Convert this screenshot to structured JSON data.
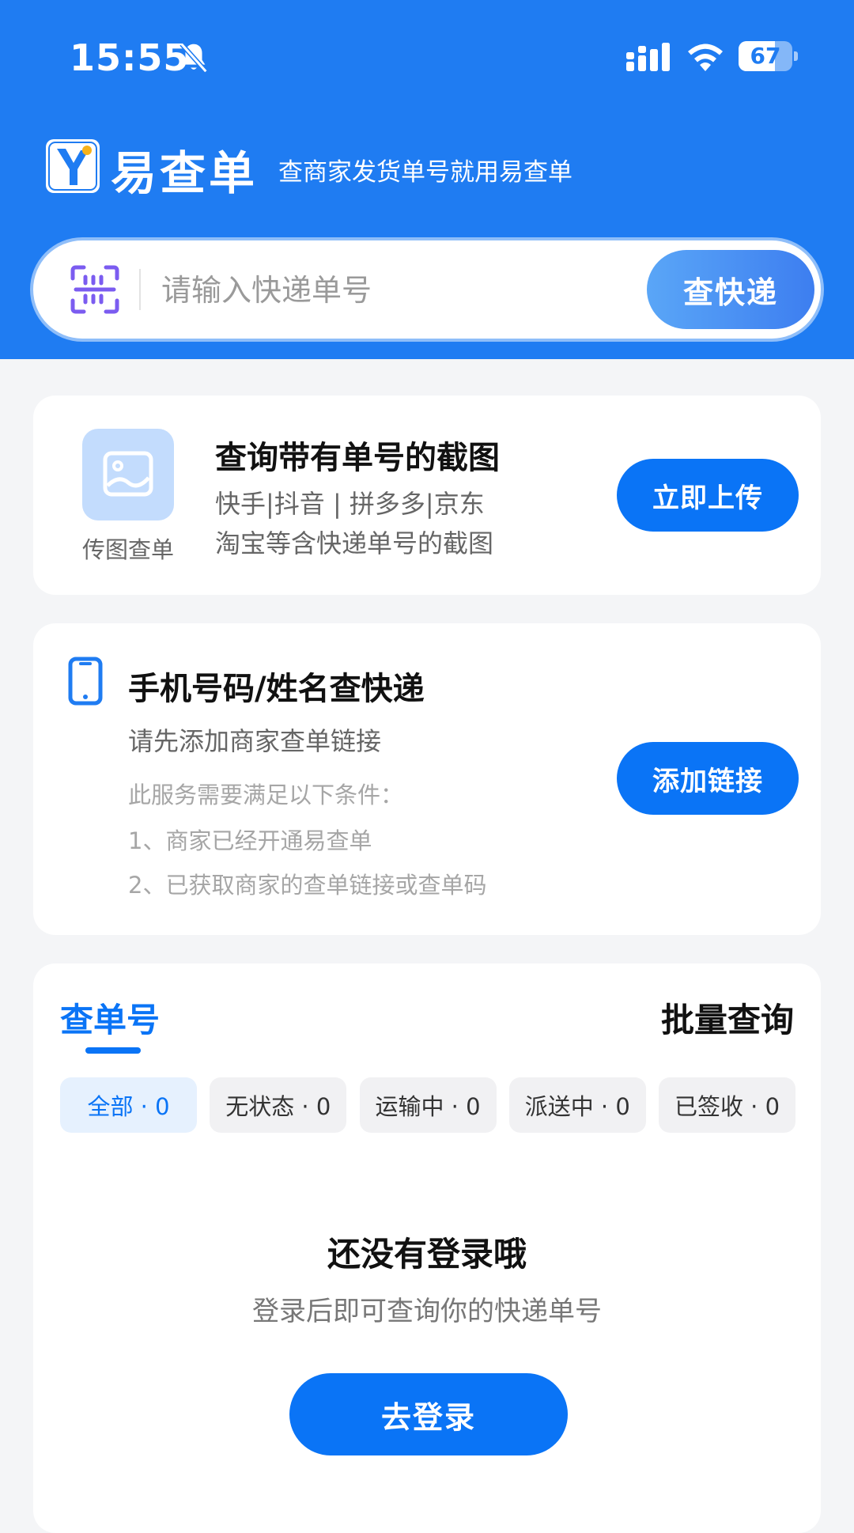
{
  "status_bar": {
    "time": "15:55",
    "battery": "67",
    "battery_level": 0.67
  },
  "brand": {
    "app_name": "易查单",
    "slogan": "查商家发货单号就用易查单"
  },
  "search": {
    "placeholder": "请输入快递单号",
    "button_label": "查快递"
  },
  "upload_card": {
    "icon_label": "传图查单",
    "title": "查询带有单号的截图",
    "desc_line1": "快手|抖音 | 拼多多|京东",
    "desc_line2": "淘宝等含快递单号的截图",
    "button_label": "立即上传"
  },
  "phone_card": {
    "title": "手机号码/姓名查快递",
    "subtitle": "请先添加商家查单链接",
    "conditions_title": "此服务需要满足以下条件：",
    "condition1": "1、商家已经开通易查单",
    "condition2": "2、已获取商家的查单链接或查单码",
    "button_label": "添加链接"
  },
  "orders": {
    "tab_active": "查单号",
    "batch_label": "批量查询",
    "filters": [
      {
        "label": "全部 · 0"
      },
      {
        "label": "无状态 · 0"
      },
      {
        "label": "运输中 · 0"
      },
      {
        "label": "派送中 · 0"
      },
      {
        "label": "已签收 · 0"
      }
    ],
    "empty_title": "还没有登录哦",
    "empty_subtitle": "登录后即可查询你的快递单号",
    "login_label": "去登录"
  },
  "colors": {
    "primary": "#0a74f6",
    "header": "#1f7cf2",
    "scan_icon": "#7b5cf0"
  }
}
